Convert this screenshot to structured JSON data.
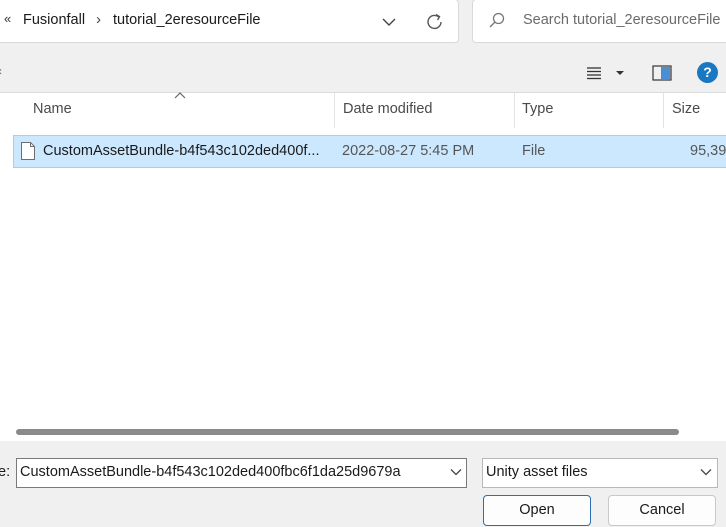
{
  "address_bar": {
    "overflow_glyph": "«",
    "breadcrumbs": [
      "Fusionfall",
      "tutorial_2eresourceFile"
    ],
    "separator": "›"
  },
  "search": {
    "placeholder": "Search tutorial_2eresourceFile"
  },
  "command_strip": {
    "left_glyph": "‹"
  },
  "help": {
    "label": "?"
  },
  "file_list": {
    "columns": [
      "Name",
      "Date modified",
      "Type",
      "Size"
    ],
    "rows": [
      {
        "name": "CustomAssetBundle-b4f543c102ded400f...",
        "date_modified": "2022-08-27 5:45 PM",
        "type": "File",
        "size": "95,39"
      }
    ],
    "selected_row": 0,
    "horizontal_scroll_fraction_visible": 0.91
  },
  "bottom": {
    "filename_label": "e:",
    "filename_value": "CustomAssetBundle-b4f543c102ded400fbc6f1da25d9679a",
    "filetype_value": "Unity asset files",
    "open_label": "Open",
    "cancel_label": "Cancel"
  },
  "icons": {
    "search": "search-icon",
    "refresh": "refresh-icon",
    "dropdown": "chevron-down-icon",
    "view_menu": "list-view-icon",
    "preview_pane": "preview-pane-icon",
    "help": "help-icon",
    "file": "file-icon",
    "sort": "sort-up-icon"
  },
  "colors": {
    "selection_fill": "#cce8ff",
    "selection_border": "#99d1ff",
    "help_blue": "#1a78c2",
    "primary_button_border": "#2a6fb5"
  }
}
